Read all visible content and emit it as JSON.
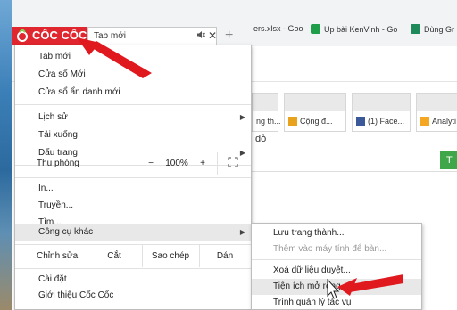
{
  "browser": {
    "logo_text": "CỐC CỐC",
    "tab_title": "Tab mới",
    "mute_glyph": "🔇",
    "close_glyph": "✕",
    "new_tab_glyph": "+"
  },
  "bookmarks": [
    {
      "label": "ers.xlsx - Goo",
      "color": "#2a7a3c"
    },
    {
      "label": "Up bài KenVinh - Go",
      "color": "#1f9e4a"
    },
    {
      "label": "Dùng Gr",
      "color": "#1e8a5a"
    }
  ],
  "thumbnails": [
    {
      "label": "ng th..."
    },
    {
      "label": "Cộng đ...",
      "fav_color": "#e8a21c"
    },
    {
      "label": "(1) Face...",
      "fav_color": "#3b5998"
    },
    {
      "label": "Analyti",
      "fav_color": "#f5a623"
    }
  ],
  "background_text": {
    "fragment": "dỏ",
    "green_button": "T"
  },
  "menu": {
    "items_top": [
      "Tab mới",
      "Cửa sổ Mới",
      "Cửa sổ ẩn danh mới"
    ],
    "items_history": [
      {
        "label": "Lịch sử",
        "arrow": "▶"
      },
      {
        "label": "Tải xuống",
        "arrow": ""
      },
      {
        "label": "Dấu trang",
        "arrow": "▶"
      }
    ],
    "zoom": {
      "label": "Thu phóng",
      "minus": "−",
      "value": "100%",
      "plus": "+",
      "fullscreen": "⛶"
    },
    "items_tools": [
      {
        "label": "In...",
        "arrow": ""
      },
      {
        "label": "Truyền...",
        "arrow": ""
      },
      {
        "label": "Tìm...",
        "arrow": ""
      },
      {
        "label": "Công cụ khác",
        "arrow": "▶"
      }
    ],
    "edit": {
      "label": "Chỉnh sửa",
      "cut": "Cắt",
      "copy": "Sao chép",
      "paste": "Dán"
    },
    "items_bottom": [
      "Cài đặt",
      "Giới thiệu Cốc Cốc"
    ]
  },
  "submenu": {
    "items": [
      {
        "label": "Lưu trang thành...",
        "disabled": false
      },
      {
        "label": "Thêm vào máy tính để bàn...",
        "disabled": true
      },
      {
        "label": "Xoá dữ liệu duyệt...",
        "disabled": false
      },
      {
        "label": "Tiện ích mở rộng",
        "disabled": false
      },
      {
        "label": "Trình quản lý tác vụ",
        "disabled": false
      }
    ]
  },
  "colors": {
    "annotation_arrow": "#e0191f",
    "brand_red": "#e0262e",
    "accent_green": "#3fa74a"
  }
}
